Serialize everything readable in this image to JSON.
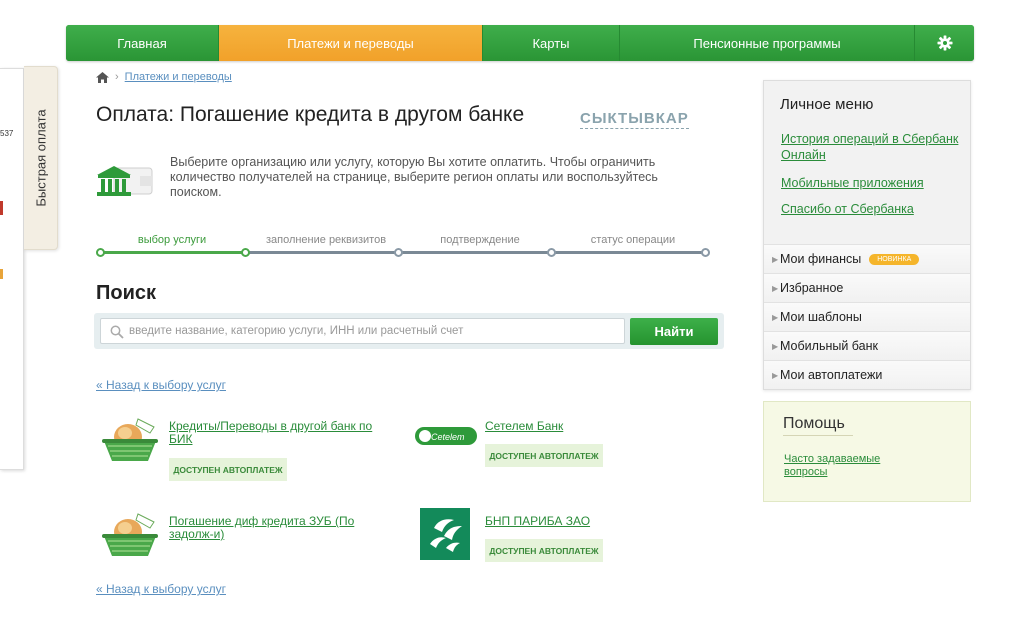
{
  "quick_pay": {
    "tab_label": "Быстрая оплата",
    "edge_fragment": "537"
  },
  "nav": {
    "items": [
      "Главная",
      "Платежи и переводы",
      "Карты",
      "Пенсионные программы"
    ],
    "active_index": 1,
    "settings_icon": "gear-icon",
    "colors": {
      "green": "#2f9e3b",
      "orange": "#f6b33e"
    }
  },
  "breadcrumb": {
    "home_icon": "home-icon",
    "current": "Платежи и переводы"
  },
  "page": {
    "title": "Оплата: Погашение кредита в другом банке",
    "city": "СЫКТЫВКАР",
    "intro": "Выберите организацию или услугу, которую Вы хотите оплатить. Чтобы ограничить количество получателей на странице, выберите регион оплаты или воспользуйтесь поиском."
  },
  "steps": {
    "items": [
      "выбор услуги",
      "заполнение реквизитов",
      "подтверждение",
      "статус операции"
    ],
    "current_index": 0
  },
  "search": {
    "title": "Поиск",
    "placeholder": "введите название, категорию услуги, ИНН или расчетный счет",
    "button": "Найти"
  },
  "back_link": "« Назад к выбору услуг",
  "services": [
    {
      "name": "Кредиты/Переводы в другой банк по БИК",
      "badge": "ДОСТУПЕН АВТОПЛАТЕЖ",
      "icon": "basket-icon"
    },
    {
      "name": "Сетелем Банк",
      "badge": "ДОСТУПЕН АВТОПЛАТЕЖ",
      "icon": "cetelem-logo",
      "logo_text": "Cetelem"
    },
    {
      "name": "Погашение диф кредита ЗУБ (По задолж-и)",
      "badge": "",
      "icon": "basket-icon"
    },
    {
      "name": "БНП ПАРИБА ЗАО",
      "badge": "ДОСТУПЕН АВТОПЛАТЕЖ",
      "icon": "bnp-paribas-logo"
    }
  ],
  "menu": {
    "title": "Личное меню",
    "links": [
      "История операций в Сбербанк Онлайн",
      "Мобильные приложения",
      "Спасибо от Сбербанка"
    ],
    "items": [
      "Мои финансы",
      "Избранное",
      "Мои шаблоны",
      "Мобильный банк",
      "Мои автоплатежи"
    ],
    "new_badge": "НОВИНКА"
  },
  "help": {
    "title": "Помощь",
    "link": "Часто задаваемые вопросы"
  }
}
